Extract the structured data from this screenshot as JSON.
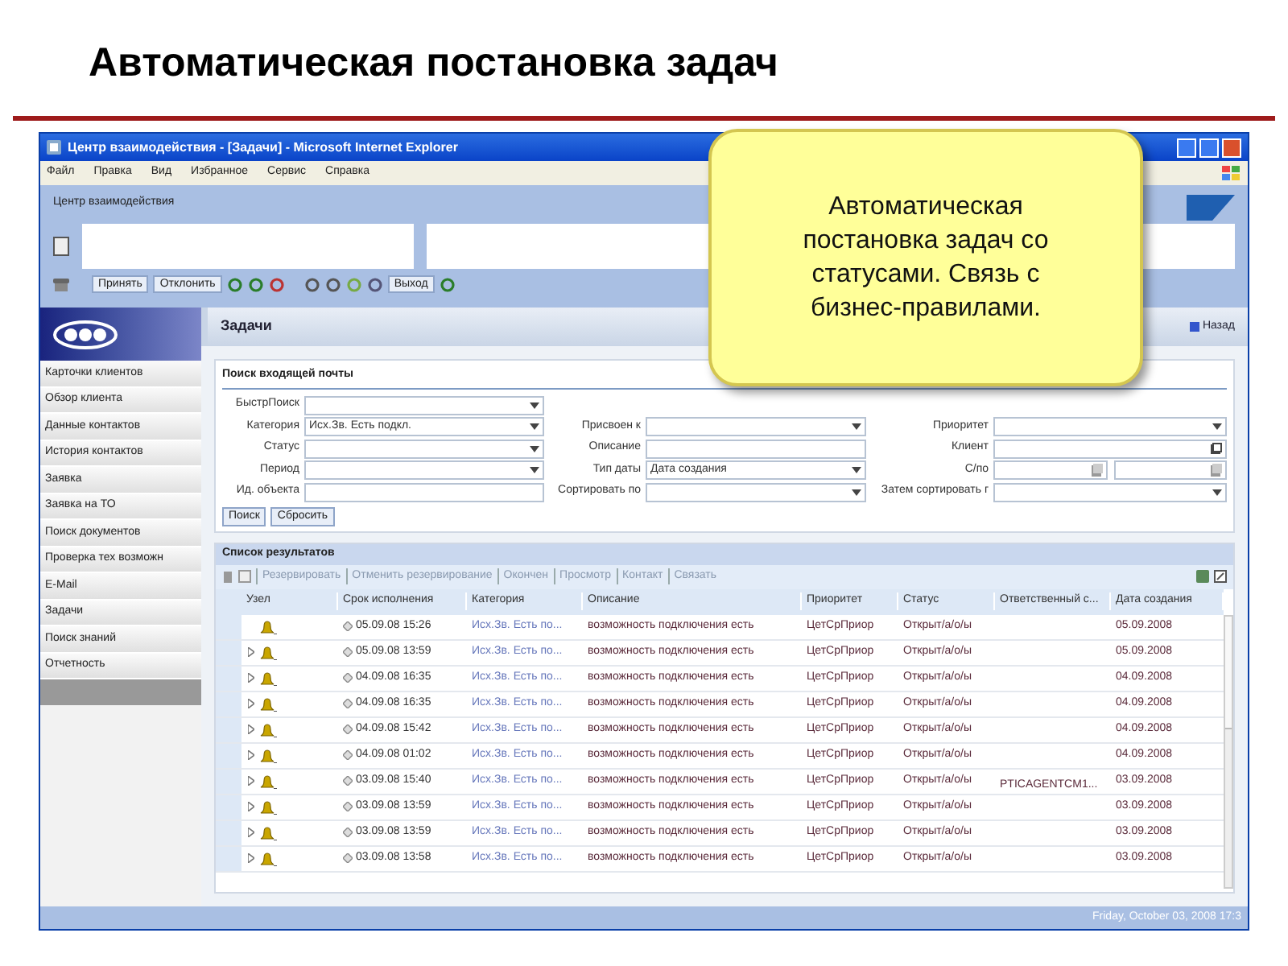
{
  "slide_title": "Автоматическая постановка задач",
  "callout": "Автоматическая постановка задач со статусами. Связь с бизнес-правилами.",
  "window": {
    "title": "Центр взаимодействия - [Задачи] - Microsoft Internet Explorer",
    "menu": [
      "Файл",
      "Правка",
      "Вид",
      "Избранное",
      "Сервис",
      "Справка"
    ],
    "app_title": "Центр взаимодействия",
    "toolbar": [
      {
        "kind": "button",
        "label": "Принять"
      },
      {
        "kind": "button",
        "label": "Отклонить"
      },
      {
        "kind": "icon"
      },
      {
        "kind": "icon"
      },
      {
        "kind": "icon"
      },
      {
        "kind": "gap"
      },
      {
        "kind": "icon"
      },
      {
        "kind": "icon"
      },
      {
        "kind": "icon"
      },
      {
        "kind": "icon"
      },
      {
        "kind": "button",
        "label": "Выход"
      },
      {
        "kind": "icon"
      }
    ],
    "sidebar": [
      {
        "label": "Карточки клиентов"
      },
      {
        "label": "Обзор клиента"
      },
      {
        "label": "Данные контактов"
      },
      {
        "label": "История контактов"
      },
      {
        "label": "Заявка"
      },
      {
        "label": "Заявка на ТО"
      },
      {
        "label": "Поиск документов"
      },
      {
        "label": "Проверка тех возможн"
      },
      {
        "label": "E-Mail"
      },
      {
        "label": "Задачи"
      },
      {
        "label": "Поиск знаний"
      },
      {
        "label": "Отчетность"
      }
    ],
    "page_title": "Задачи",
    "back_button": "Назад",
    "search": {
      "title": "Поиск входящей почты",
      "rows": [
        [
          {
            "label": "БыстрПоиск",
            "kind": "dropdown",
            "wide": true
          }
        ],
        [
          {
            "label": "Категория",
            "kind": "dropdown",
            "value": "Исх.Зв. Есть подкл."
          },
          {
            "label": "Присвоен к",
            "kind": "dropdown"
          },
          {
            "label": "Приоритет",
            "kind": "dropdown"
          }
        ],
        [
          {
            "label": "Статус",
            "kind": "dropdown"
          },
          {
            "label": "Описание",
            "kind": "text"
          },
          {
            "label": "Клиент",
            "kind": "lookup"
          }
        ],
        [
          {
            "label": "Период",
            "kind": "dropdown"
          },
          {
            "label": "Тип даты",
            "kind": "dropdown",
            "value": "Дата создания"
          },
          {
            "label": "С/по",
            "kind": "date_range"
          }
        ],
        [
          {
            "label": "Ид. объекта",
            "kind": "text"
          },
          {
            "label": "Сортировать по",
            "kind": "dropdown"
          },
          {
            "label": "Затем сортировать г",
            "kind": "dropdown"
          }
        ]
      ],
      "buttons": [
        "Поиск",
        "Сбросить"
      ]
    },
    "results": {
      "title": "Список результатов",
      "actions": [
        "Резервировать",
        "Отменить резервирование",
        "Окончен",
        "Просмотр",
        "Контакт",
        "Связать"
      ],
      "columns": [
        "Узел",
        "Срок исполнения",
        "Категория",
        "Описание",
        "Приоритет",
        "Статус",
        "Ответственный с...",
        "Дата создания"
      ],
      "rows": [
        {
          "expandable": false,
          "due": "05.09.08 15:26",
          "category": "Исх.Зв. Есть по...",
          "description": "возможность подключения есть",
          "priority": "ЦетСрПриор",
          "status": "Открыт/а/о/ы",
          "owner": "",
          "created": "05.09.2008"
        },
        {
          "expandable": true,
          "due": "05.09.08 13:59",
          "category": "Исх.Зв. Есть по...",
          "description": "возможность подключения есть",
          "priority": "ЦетСрПриор",
          "status": "Открыт/а/о/ы",
          "owner": "",
          "created": "05.09.2008"
        },
        {
          "expandable": true,
          "due": "04.09.08 16:35",
          "category": "Исх.Зв. Есть по...",
          "description": "возможность подключения есть",
          "priority": "ЦетСрПриор",
          "status": "Открыт/а/о/ы",
          "owner": "",
          "created": "04.09.2008"
        },
        {
          "expandable": true,
          "due": "04.09.08 16:35",
          "category": "Исх.Зв. Есть по...",
          "description": "возможность подключения есть",
          "priority": "ЦетСрПриор",
          "status": "Открыт/а/о/ы",
          "owner": "",
          "created": "04.09.2008"
        },
        {
          "expandable": true,
          "due": "04.09.08 15:42",
          "category": "Исх.Зв. Есть по...",
          "description": "возможность подключения есть",
          "priority": "ЦетСрПриор",
          "status": "Открыт/а/о/ы",
          "owner": "",
          "created": "04.09.2008"
        },
        {
          "expandable": true,
          "due": "04.09.08 01:02",
          "category": "Исх.Зв. Есть по...",
          "description": "возможность подключения есть",
          "priority": "ЦетСрПриор",
          "status": "Открыт/а/о/ы",
          "owner": "",
          "created": "04.09.2008"
        },
        {
          "expandable": true,
          "due": "03.09.08 15:40",
          "category": "Исх.Зв. Есть по...",
          "description": "возможность подключения есть",
          "priority": "ЦетСрПриор",
          "status": "Открыт/а/о/ы",
          "owner": "PTICAGENTCM1...",
          "created": "03.09.2008"
        },
        {
          "expandable": true,
          "due": "03.09.08 13:59",
          "category": "Исх.Зв. Есть по...",
          "description": "возможность подключения есть",
          "priority": "ЦетСрПриор",
          "status": "Открыт/а/о/ы",
          "owner": "",
          "created": "03.09.2008"
        },
        {
          "expandable": true,
          "due": "03.09.08 13:59",
          "category": "Исх.Зв. Есть по...",
          "description": "возможность подключения есть",
          "priority": "ЦетСрПриор",
          "status": "Открыт/а/о/ы",
          "owner": "",
          "created": "03.09.2008"
        },
        {
          "expandable": true,
          "due": "03.09.08 13:58",
          "category": "Исх.Зв. Есть по...",
          "description": "возможность подключения есть",
          "priority": "ЦетСрПриор",
          "status": "Открыт/а/о/ы",
          "owner": "",
          "created": "03.09.2008"
        }
      ]
    },
    "status_bar": "Friday, October 03, 2008 17:3"
  }
}
